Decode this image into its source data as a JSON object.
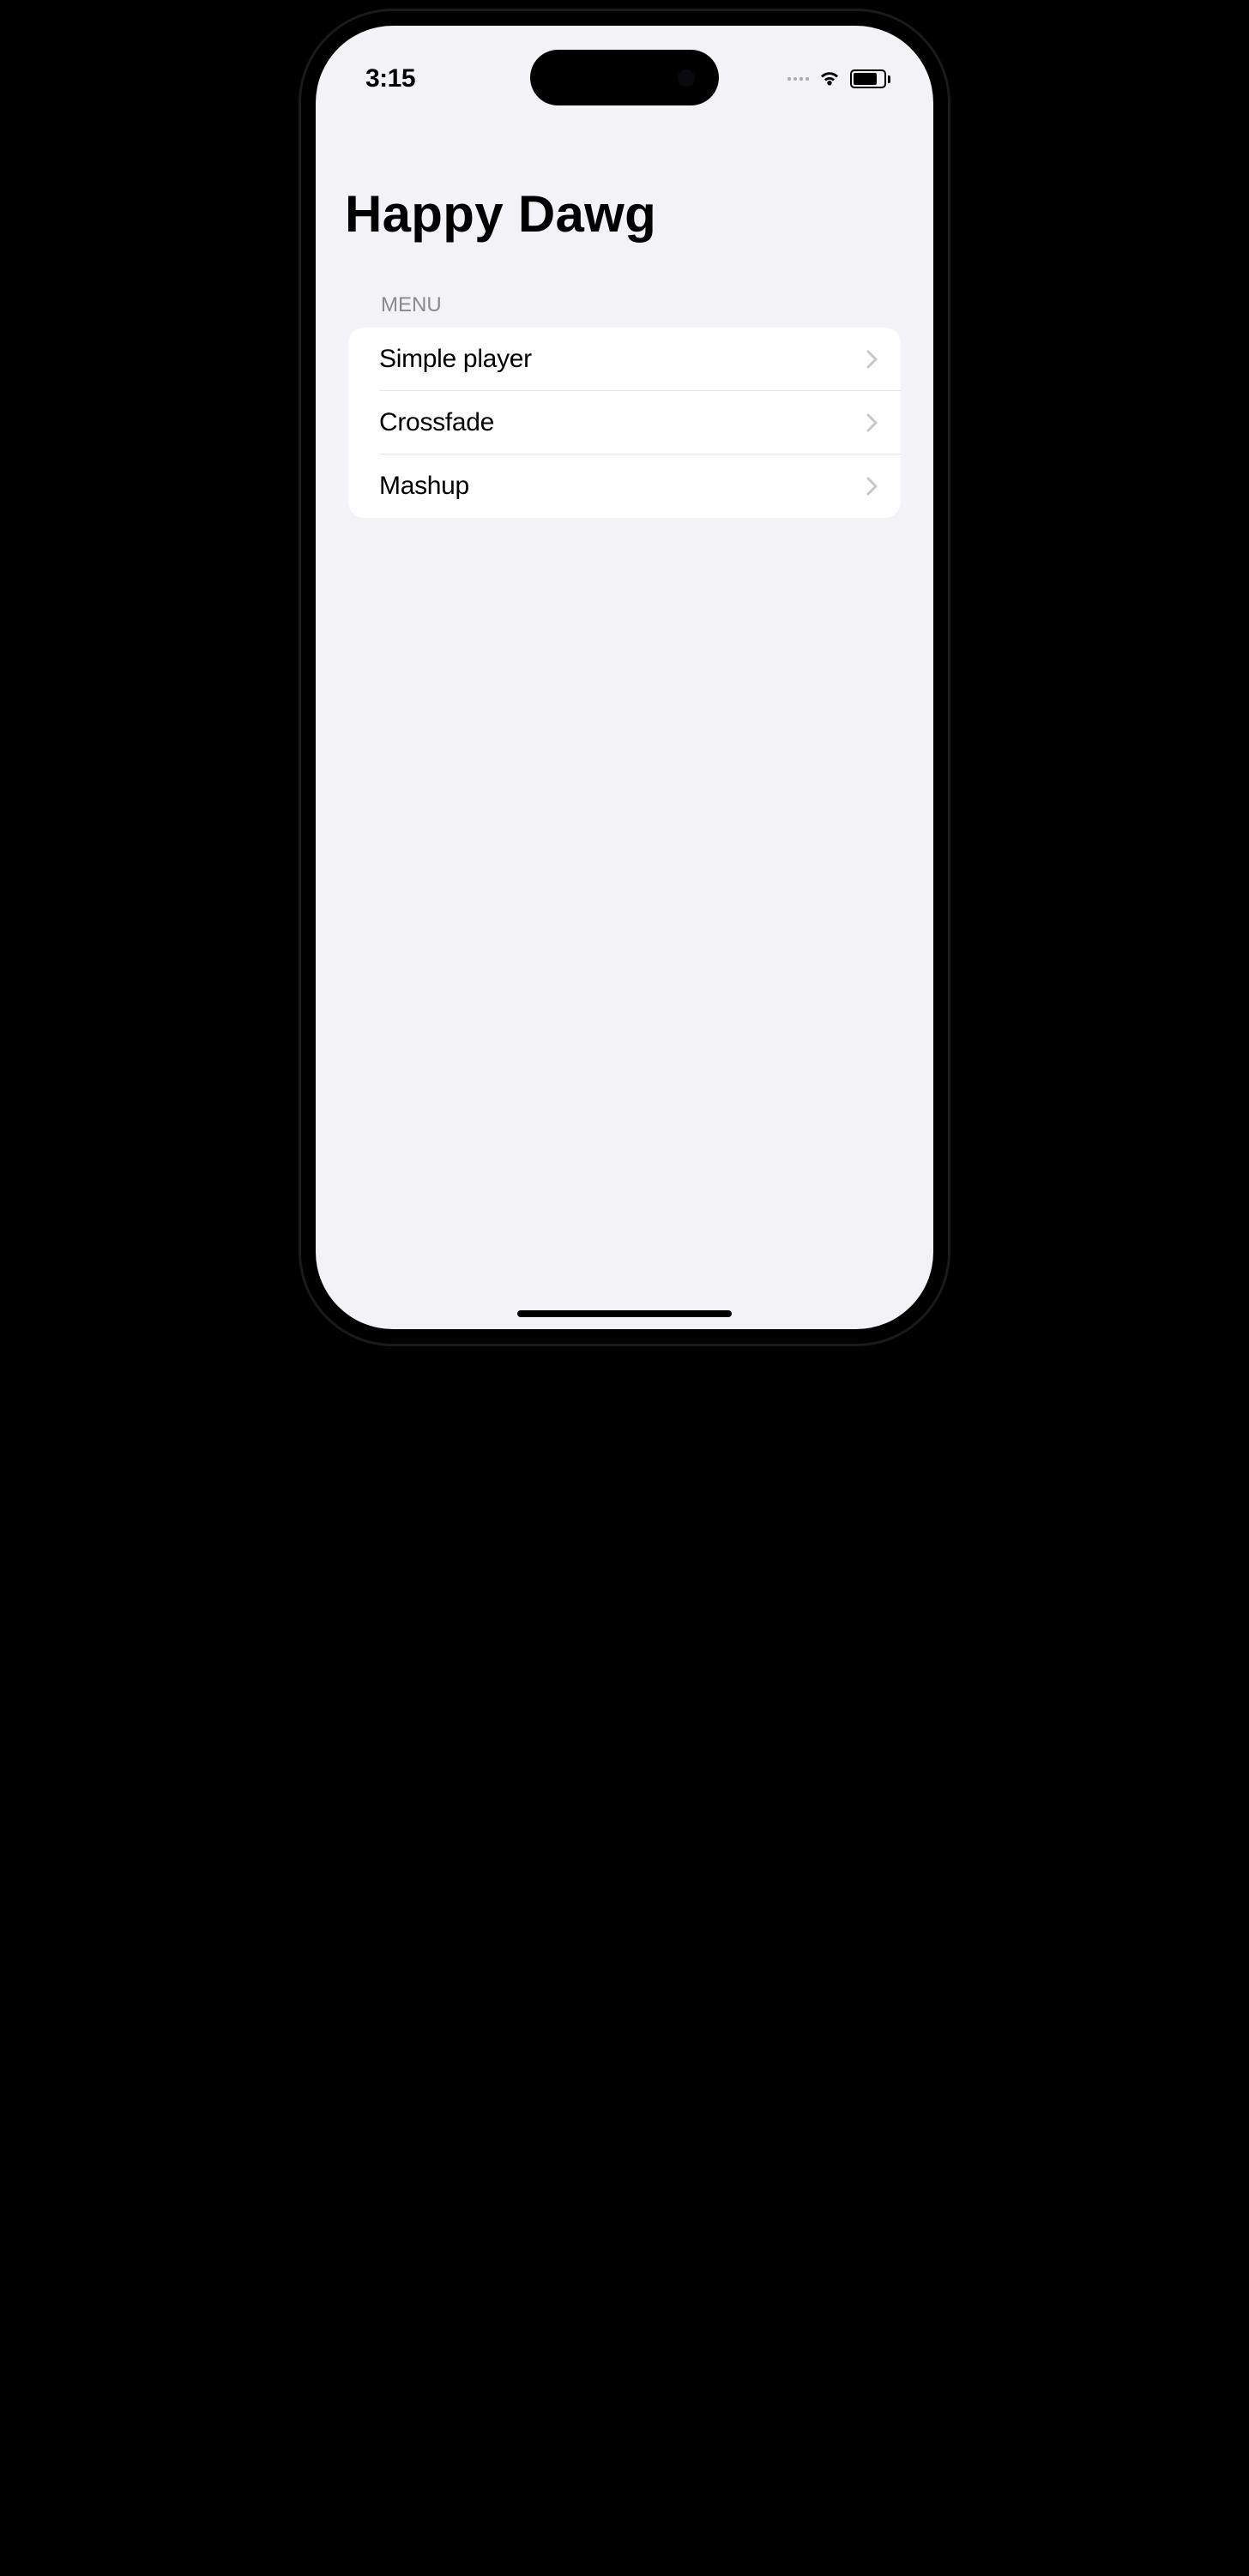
{
  "statusBar": {
    "time": "3:15"
  },
  "header": {
    "title": "Happy Dawg"
  },
  "section": {
    "label": "MENU"
  },
  "menu": {
    "items": [
      {
        "label": "Simple player"
      },
      {
        "label": "Crossfade"
      },
      {
        "label": "Mashup"
      }
    ]
  }
}
